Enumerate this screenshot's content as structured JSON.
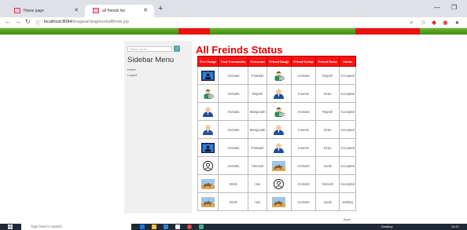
{
  "browser": {
    "tabs": [
      {
        "title": "Home page"
      },
      {
        "title": "all friends list"
      }
    ],
    "url_host": "localhost:8084",
    "url_path": "/imagearrangment/allfrnds.jsp"
  },
  "sidebar": {
    "search_placeholder": "Search our ite",
    "title": "Sidebar Menu",
    "links": [
      {
        "label": "Home"
      },
      {
        "label": "Logout"
      }
    ]
  },
  "main": {
    "title": "All Freinds Status",
    "columns": [
      "User Image",
      "User Community",
      "Username",
      "Friend Image",
      "Friend Group",
      "Friend Name",
      "Status"
    ],
    "rows": [
      {
        "user_icon": "monitor-person-icon",
        "community": "Animals",
        "username": "Prakash",
        "friend_icon": "developer-avatar-icon",
        "group": "Animals",
        "friend": "Rajesh",
        "status": "Accepted"
      },
      {
        "user_icon": "developer-avatar-icon",
        "community": "Animals",
        "username": "Rajesh",
        "friend_icon": "suit-avatar-icon",
        "group": "Insects",
        "friend": "Kiran",
        "status": "Accepted"
      },
      {
        "user_icon": "suit-avatar-icon",
        "community": "Animals",
        "username": "Manjunath",
        "friend_icon": "developer-avatar-icon",
        "group": "Animals",
        "friend": "Rajesh",
        "status": "Accepted"
      },
      {
        "user_icon": "suit-avatar-icon",
        "community": "Animals",
        "username": "Manjunath",
        "friend_icon": "suit-avatar-icon",
        "group": "Insects",
        "friend": "Kiran",
        "status": "Accepted"
      },
      {
        "user_icon": "monitor-person-icon",
        "community": "Animals",
        "username": "Prakash",
        "friend_icon": "suit-avatar-icon",
        "group": "Insects",
        "friend": "Kiran",
        "status": "Accepted"
      },
      {
        "user_icon": "outline-person-icon",
        "community": "Animals",
        "username": "Yamesh",
        "friend_icon": "camel-photo-icon",
        "group": "Animals",
        "friend": "ravali",
        "status": "Accepted"
      },
      {
        "user_icon": "camel-photo-icon",
        "community": "Birds",
        "username": "ravi",
        "friend_icon": "outline-person-icon",
        "group": "Animals",
        "friend": "Yamesh",
        "status": "Accepted"
      },
      {
        "user_icon": "camel-photo-icon",
        "community": "Birds",
        "username": "ravi",
        "friend_icon": "camel-photo-icon",
        "group": "Animals",
        "friend": "ravali",
        "status": "waiting"
      }
    ],
    "footer_link": "Back"
  },
  "taskbar": {
    "search_placeholder": "Type here to search",
    "desktop_label": "Desktop",
    "time": "11:47"
  },
  "colors": {
    "accent_red": "#ee1111",
    "header_green": "#4a9d1f"
  }
}
